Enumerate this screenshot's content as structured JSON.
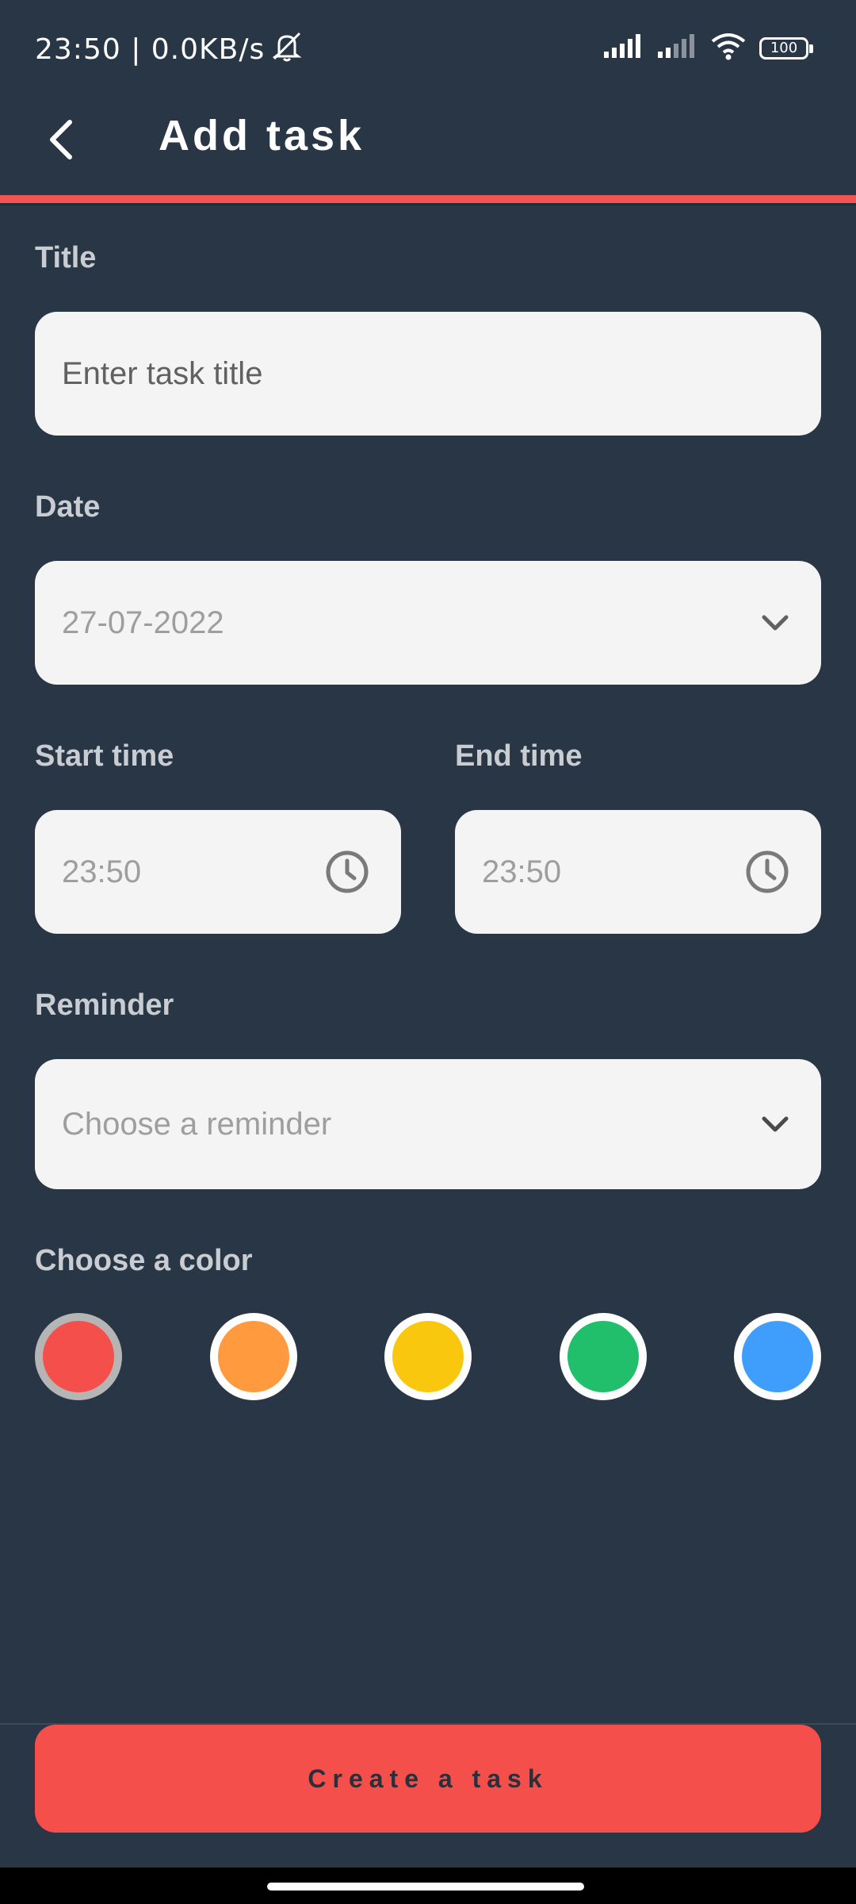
{
  "status_bar": {
    "time_speed": "23:50 | 0.0KB/s",
    "battery": "100",
    "icons": [
      "bell-muted-icon",
      "signal-icon",
      "signal-icon",
      "wifi-icon",
      "battery-icon"
    ]
  },
  "app_bar": {
    "title": "Add task",
    "back_icon": "chevron-left-icon"
  },
  "form": {
    "title_label": "Title",
    "title_placeholder": "Enter task title",
    "date_label": "Date",
    "date_value": "27-07-2022",
    "start_label": "Start time",
    "start_value": "23:50",
    "end_label": "End time",
    "end_value": "23:50",
    "reminder_label": "Reminder",
    "reminder_placeholder": "Choose a reminder",
    "color_label": "Choose a color",
    "colors": [
      "#f44f4a",
      "#ff9a3e",
      "#f9c80e",
      "#21bf6b",
      "#3f9efc"
    ],
    "selected_color_index": 0
  },
  "actions": {
    "create_label": "Create a task"
  },
  "theme": {
    "background": "#283646",
    "accent": "#f25454",
    "field_bg": "#f4f4f4"
  }
}
